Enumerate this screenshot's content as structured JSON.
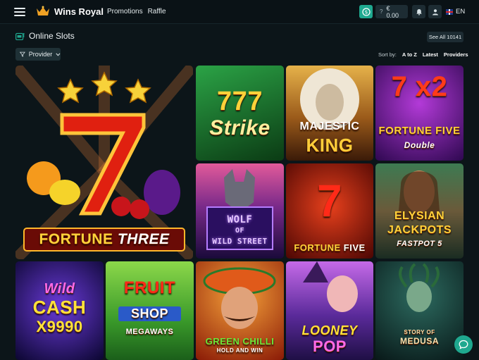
{
  "header": {
    "brand": "Wins Royal",
    "nav": [
      "Promotions",
      "Raffle"
    ],
    "balance": "€ 0.00",
    "help_glyph": "?",
    "language": "EN"
  },
  "section": {
    "title": "Online Slots",
    "see_all": "See All 10141"
  },
  "filter": {
    "provider_label": "Provider"
  },
  "sort": {
    "label": "Sort by:",
    "options": [
      "A to Z",
      "Latest",
      "Providers"
    ]
  },
  "games": [
    {
      "title": "Fortune Three",
      "line1": "FORTUNE",
      "line2": "THREE",
      "colors": [
        "#d9281c",
        "#6a0b06"
      ]
    },
    {
      "title": "777 Strike",
      "line1": "777",
      "line2": "Strike",
      "colors": [
        "#1e8a36",
        "#0b3b14"
      ]
    },
    {
      "title": "Majestic King",
      "line1": "MAJESTIC",
      "line2": "KING",
      "colors": [
        "#d39424",
        "#5a2a0b"
      ]
    },
    {
      "title": "Fortune Five Double",
      "line1": "7 x2",
      "line2": "FORTUNE FIVE",
      "line3": "Double",
      "colors": [
        "#8a1ec7",
        "#2e0850"
      ]
    },
    {
      "title": "Wolf of Wild Street",
      "line1": "WOLF",
      "line2": "OF",
      "line3": "WILD STREET",
      "colors": [
        "#c43c8a",
        "#2a0f45"
      ]
    },
    {
      "title": "Fortune Five",
      "line1": "7",
      "line2": "FORTUNE",
      "line3": "FIVE",
      "colors": [
        "#c81e14",
        "#4b0603"
      ]
    },
    {
      "title": "Elysian Jackpots Fastpot 5",
      "line1": "ELYSIAN",
      "line2": "JACKPOTS",
      "line3": "FASTPOT 5",
      "colors": [
        "#3d7a52",
        "#1a2c22"
      ]
    },
    {
      "title": "Wild Cash x9990",
      "line1": "Wild",
      "line2": "CASH",
      "line3": "X9990",
      "colors": [
        "#3b1b93",
        "#0b0630"
      ]
    },
    {
      "title": "Fruit Shop Megaways",
      "line1": "FRUIT",
      "line2": "SHOP",
      "line3": "MEGAWAYS",
      "colors": [
        "#72c93c",
        "#1b5f1a"
      ]
    },
    {
      "title": "Green Chilli Hold and Win",
      "line1": "GREEN CHILLI",
      "line2": "HOLD AND WIN",
      "colors": [
        "#d4501a",
        "#4a1406"
      ]
    },
    {
      "title": "Looney Pop",
      "line1": "LOONEY",
      "line2": "POP",
      "colors": [
        "#9d4fd4",
        "#1f0f45"
      ]
    },
    {
      "title": "Story of Medusa",
      "line1": "STORY OF",
      "line2": "MEDUSA",
      "colors": [
        "#1d4d4a",
        "#081818"
      ]
    }
  ],
  "colors": {
    "background": "#0c1519",
    "accent": "#1fa88f",
    "button": "#1d2c33"
  }
}
